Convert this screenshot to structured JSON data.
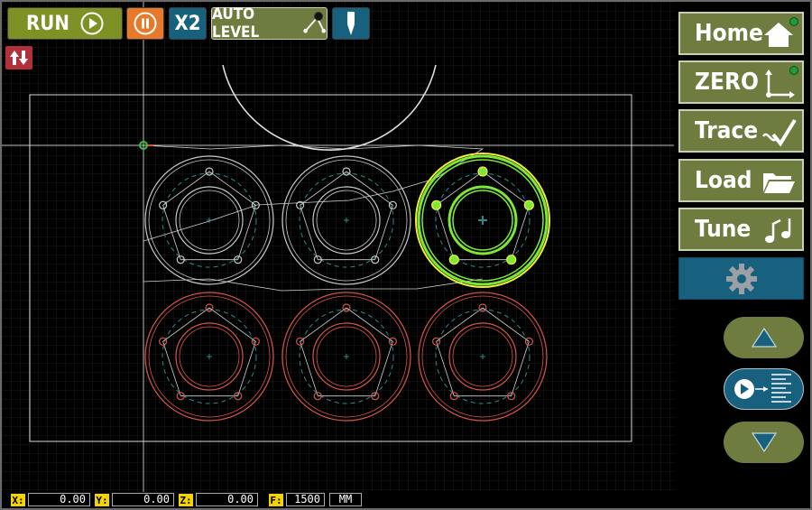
{
  "toolbar": {
    "run_label": "RUN",
    "x2_label": "X2",
    "auto_level_label": "AUTO LEVEL"
  },
  "sidebar": {
    "home_label": "Home",
    "zero_label": "ZERO",
    "trace_label": "Trace",
    "load_label": "Load",
    "tune_label": "Tune"
  },
  "status": {
    "x_label": "X:",
    "x_value": "0.00",
    "y_label": "Y:",
    "y_value": "0.00",
    "z_label": "Z:",
    "z_value": "0.00",
    "f_label": "F:",
    "f_value": "1500",
    "unit": "MM"
  },
  "colors": {
    "olive": "#7e9124",
    "teal": "#17607e",
    "pause_orange": "#e8782a",
    "selected_part": "#7ee83a",
    "queued_part": "#d8544a",
    "completed_part": "#c8c8c8"
  }
}
